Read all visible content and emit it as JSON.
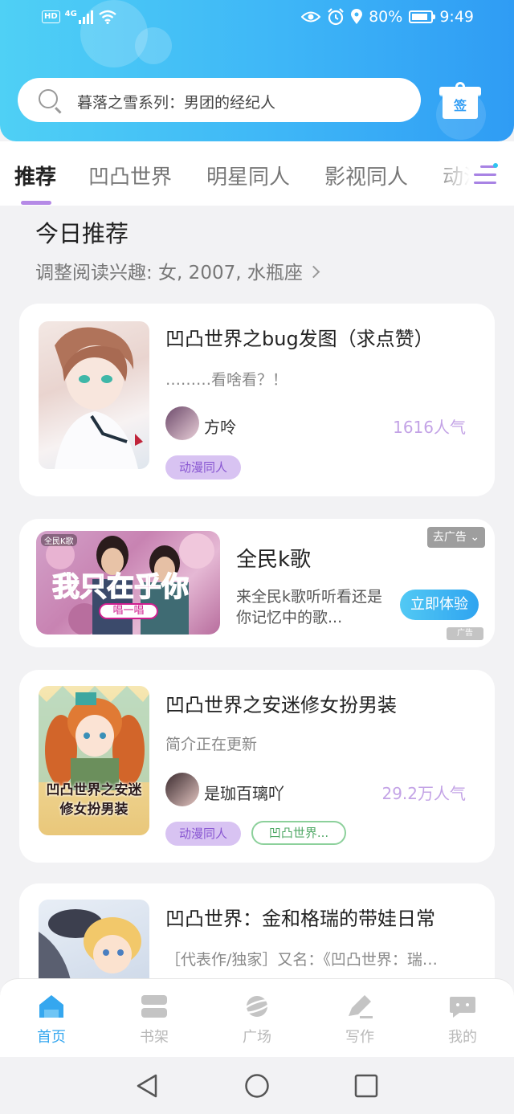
{
  "status_bar": {
    "network": "4G",
    "hd": "HD",
    "battery": "80%",
    "time": "9:49"
  },
  "search": {
    "placeholder": "暮落之雪系列：男团的经纪人"
  },
  "gift": {
    "label": "签"
  },
  "tabs": [
    {
      "label": "推荐",
      "active": true
    },
    {
      "label": "凹凸世界"
    },
    {
      "label": "明星同人"
    },
    {
      "label": "影视同人"
    },
    {
      "label": "动漫"
    }
  ],
  "section": {
    "title": "今日推荐",
    "interest": "调整阅读兴趣: 女, 2007, 水瓶座"
  },
  "books": [
    {
      "title": "凹凸世界之bug发图（求点赞）",
      "description": "………看啥看？！",
      "author": "方呤",
      "popularity": "1616人气",
      "tags": [
        "动漫同人"
      ]
    },
    {
      "title": "凹凸世界之安迷修女扮男装",
      "description": "简介正在更新",
      "author": "是珈百璃吖",
      "popularity": "29.2万人气",
      "tags": [
        "动漫同人",
        "凹凸世界..."
      ],
      "cover_text": "凹凸世界之安迷修女扮男装"
    },
    {
      "title": "凹凸世界：金和格瑞的带娃日常",
      "description": "［代表作/独家］又名：《凹凸世界：瑞…"
    }
  ],
  "ad": {
    "title": "全民k歌",
    "description": "来全民k歌听听看还是你记忆中的歌...",
    "button": "立即体验",
    "close_label": "去广告",
    "ad_mark": "广告",
    "image_brand": "全民K歌",
    "image_headline": "我只在乎你",
    "image_sub": "唱一唱"
  },
  "bottom_nav": [
    {
      "label": "首页",
      "icon": "home-icon",
      "active": true
    },
    {
      "label": "书架",
      "icon": "bookshelf-icon"
    },
    {
      "label": "广场",
      "icon": "planet-icon"
    },
    {
      "label": "写作",
      "icon": "pen-icon"
    },
    {
      "label": "我的",
      "icon": "chat-bubble-icon"
    }
  ],
  "colors": {
    "accent": "#35a7ef",
    "tab_underline": "#b58ae6",
    "popularity": "#c3a3e6",
    "tag_bg": "#d8c3f2"
  }
}
